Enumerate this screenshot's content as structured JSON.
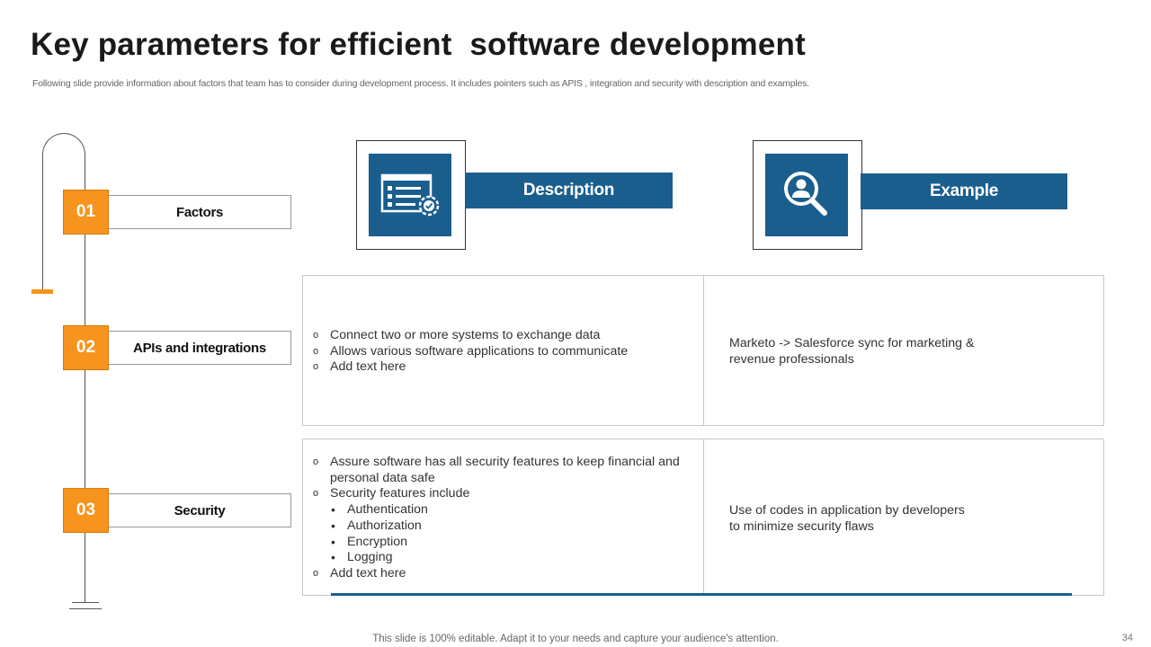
{
  "slide": {
    "title": "Key parameters for efficient  software development",
    "subtitle": "Following slide provide information about factors that team has to consider during development process. It includes pointers such as APIS ,  integration and security with description and examples.",
    "footer": "This slide is 100% editable. Adapt it to your needs and capture your audience's attention.",
    "page_number": "34"
  },
  "steps": [
    {
      "number": "01",
      "label": "Factors"
    },
    {
      "number": "02",
      "label": "APIs and integrations"
    },
    {
      "number": "03",
      "label": "Security"
    }
  ],
  "headers": {
    "description": {
      "label": "Description",
      "icon": "checklist-settings-icon"
    },
    "example": {
      "label": "Example",
      "icon": "person-search-icon"
    }
  },
  "rows": [
    {
      "description": [
        {
          "marker": "o",
          "text": "Connect two or more systems to exchange data"
        },
        {
          "marker": "o",
          "text": "Allows various software applications to communicate"
        },
        {
          "marker": "o",
          "text": "Add text here"
        }
      ],
      "example": [
        "Marketo -> Salesforce sync for marketing &",
        "revenue professionals"
      ]
    },
    {
      "description": [
        {
          "marker": "o",
          "text": "Assure software has all security features to keep financial and"
        },
        {
          "marker": "",
          "text": "personal data safe"
        },
        {
          "marker": "o",
          "text": "Security features include"
        },
        {
          "marker": "•",
          "text": "Authentication"
        },
        {
          "marker": "•",
          "text": "Authorization"
        },
        {
          "marker": "•",
          "text": "Encryption"
        },
        {
          "marker": "•",
          "text": "Logging"
        },
        {
          "marker": "o",
          "text": "Add text here"
        }
      ],
      "example": [
        "Use of codes in application by developers",
        "to minimize security flaws"
      ]
    }
  ],
  "colors": {
    "accent_orange": "#f7941d",
    "accent_blue": "#1a5e8e"
  }
}
